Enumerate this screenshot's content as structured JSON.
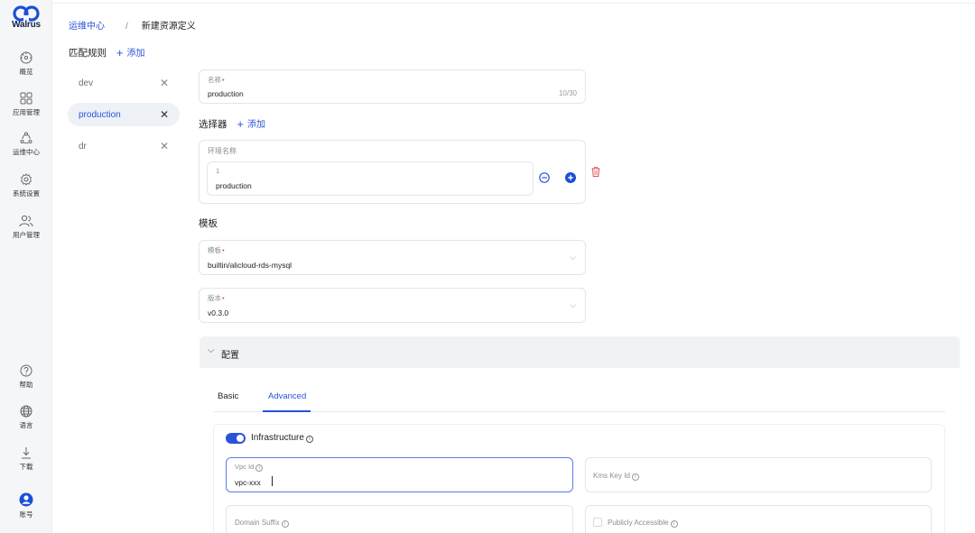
{
  "app": {
    "logo_text": "Walrus"
  },
  "nav": {
    "items": [
      {
        "label": "概览",
        "icon": "dashboard-icon"
      },
      {
        "label": "应用管理",
        "icon": "apps-grid-icon"
      },
      {
        "label": "运维中心",
        "icon": "ops-center-icon"
      },
      {
        "label": "系统设置",
        "icon": "gear-icon"
      },
      {
        "label": "用户管理",
        "icon": "users-icon"
      }
    ],
    "bottom": [
      {
        "label": "帮助",
        "icon": "help-icon"
      },
      {
        "label": "语言",
        "icon": "globe-icon"
      },
      {
        "label": "下载",
        "icon": "download-icon"
      },
      {
        "label": "账号",
        "icon": "account-icon"
      }
    ]
  },
  "breadcrumb": {
    "parent": "运维中心",
    "separator": "/",
    "current": "新建资源定义"
  },
  "rules": {
    "title": "匹配规则",
    "add_label": "添加",
    "items": [
      {
        "name": "dev"
      },
      {
        "name": "production",
        "active": true
      },
      {
        "name": "dr"
      }
    ]
  },
  "form": {
    "name": {
      "label": "名称",
      "value": "production",
      "count": "10/30"
    },
    "selector": {
      "title": "选择器",
      "add_label": "添加",
      "group_label": "环境名称",
      "item_index": "1",
      "item_value": "production"
    },
    "template_section": {
      "title": "模板"
    },
    "template": {
      "label": "模板",
      "value": "builtin/alicloud-rds-mysql"
    },
    "version": {
      "label": "版本",
      "value": "v0.3.0"
    }
  },
  "config": {
    "title": "配置",
    "tabs": [
      {
        "label": "Basic"
      },
      {
        "label": "Advanced",
        "active": true
      }
    ],
    "infrastructure_label": "Infrastructure",
    "infrastructure_enabled": true,
    "vpc_id": {
      "label": "Vpc Id",
      "value": "vpc-xxx"
    },
    "kms_key_id": {
      "label": "Kms Key Id",
      "value": ""
    },
    "domain_suffix": {
      "label": "Domain Suffix",
      "value": ""
    },
    "publicly_accessible": {
      "label": "Publicly Accessible",
      "checked": false
    }
  },
  "colors": {
    "accent": "#2a53d9",
    "danger": "#e24c4c"
  }
}
